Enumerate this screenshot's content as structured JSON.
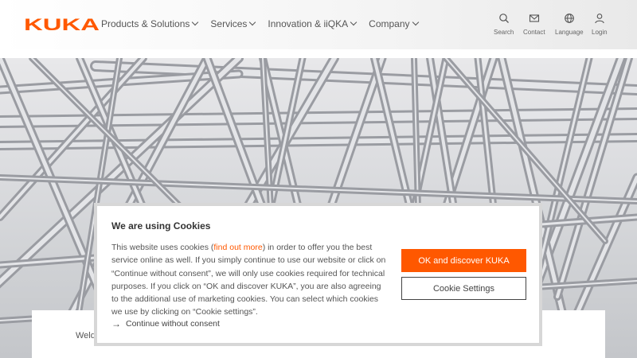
{
  "brand": {
    "name": "KUKA",
    "color": "#ff5800"
  },
  "nav": {
    "items": [
      {
        "label": "Products & Solutions"
      },
      {
        "label": "Services"
      },
      {
        "label": "Innovation & iiQKA"
      },
      {
        "label": "Company"
      }
    ]
  },
  "utility": {
    "search": {
      "label": "Search",
      "icon": "search-icon"
    },
    "contact": {
      "label": "Contact",
      "icon": "mail-icon"
    },
    "language": {
      "label": "Language",
      "icon": "globe-icon"
    },
    "login": {
      "label": "Login",
      "icon": "user-icon"
    }
  },
  "hero": {
    "image": "aluminium-tube-truss-structure"
  },
  "card": {
    "text": "Weldi"
  },
  "cookie": {
    "title": "We are using Cookies",
    "body_pre": "This website uses cookies (",
    "link": "find out more",
    "body_post": ") in order to offer you the best service online as well. If you simply continue to use our website or click on “Continue without consent”, we will only use cookies required for technical purposes. If you click on “OK and discover KUKA”, you are also agreeing to the additional use of marketing cookies. You can select which cookies we use by clicking on “Cookie settings”.",
    "continue": "Continue without consent",
    "ok_button": "OK and discover KUKA",
    "settings_button": "Cookie Settings"
  }
}
